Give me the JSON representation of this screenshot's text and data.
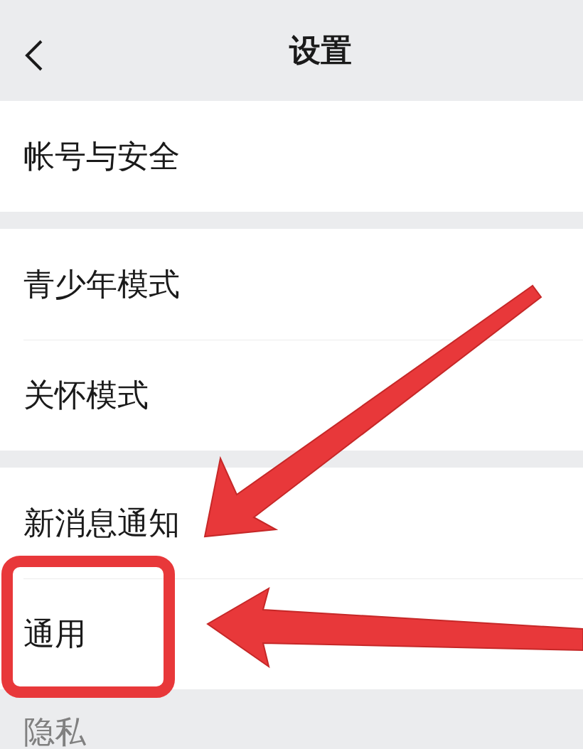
{
  "header": {
    "title": "设置"
  },
  "groups": [
    {
      "items": [
        {
          "label": "帐号与安全"
        }
      ]
    },
    {
      "items": [
        {
          "label": "青少年模式"
        },
        {
          "label": "关怀模式"
        }
      ]
    },
    {
      "items": [
        {
          "label": "新消息通知"
        },
        {
          "label": "通用"
        }
      ]
    }
  ],
  "section_label": "隐私",
  "annotations": [
    {
      "kind": "arrow"
    },
    {
      "kind": "arrow"
    },
    {
      "kind": "box"
    }
  ]
}
